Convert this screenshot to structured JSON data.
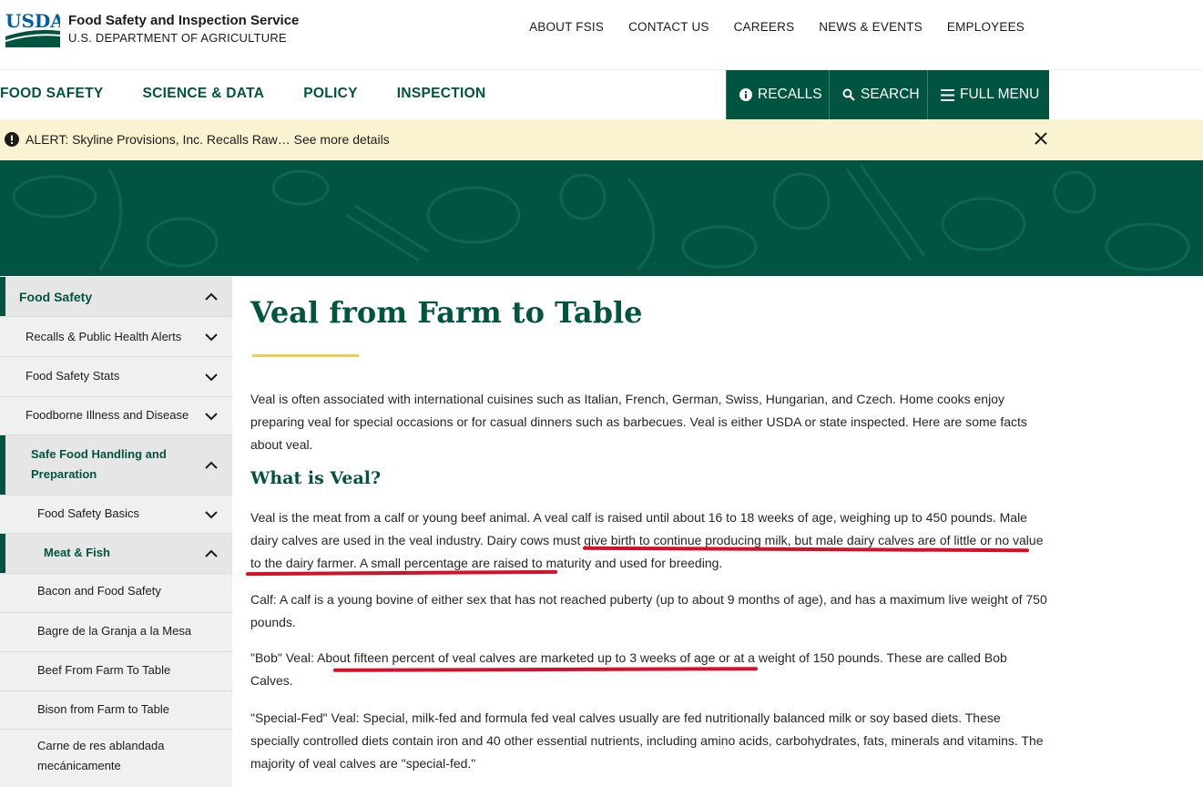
{
  "header": {
    "logo_text": "USDA",
    "agency_name": "Food Safety and Inspection Service",
    "department": "U.S. DEPARTMENT OF AGRICULTURE",
    "utility_links": [
      "ABOUT FSIS",
      "CONTACT US",
      "CAREERS",
      "NEWS & EVENTS",
      "EMPLOYEES"
    ]
  },
  "nav": {
    "links": [
      "FOOD SAFETY",
      "SCIENCE & DATA",
      "POLICY",
      "INSPECTION"
    ],
    "recalls_label": "RECALLS",
    "search_label": "SEARCH",
    "menu_label": "FULL MENU"
  },
  "alert": {
    "text": "ALERT: Skyline Provisions, Inc. Recalls Raw… See more details"
  },
  "sidebar": {
    "items": [
      {
        "label": "Food Safety",
        "chevron": "up"
      },
      {
        "label": "Recalls & Public Health Alerts",
        "chevron": "down"
      },
      {
        "label": "Food Safety Stats",
        "chevron": "down"
      },
      {
        "label": "Foodborne Illness and Disease",
        "chevron": "down"
      },
      {
        "label": "Safe Food Handling and Preparation",
        "chevron": "up"
      },
      {
        "label": "Food Safety Basics",
        "chevron": "down"
      },
      {
        "label": "Meat & Fish",
        "chevron": "up"
      },
      {
        "label": "Bacon and Food Safety"
      },
      {
        "label": "Bagre de la Granja a la Mesa"
      },
      {
        "label": "Beef From Farm To Table"
      },
      {
        "label": "Bison from Farm to Table"
      },
      {
        "label": "Carne de res ablandada mecánicamente"
      }
    ]
  },
  "main": {
    "title": "Veal from Farm to Table",
    "intro": "Veal is often associated with international cuisines such as Italian, French, German, Swiss, Hungarian, and Czech. Home cooks enjoy preparing veal for special occasions or for casual dinners such as barbecues. Veal is either USDA or state inspected. Here are some facts about veal.",
    "what_heading": "What is Veal?",
    "p1": "Veal is the meat from a calf or young beef animal. A veal calf is raised until about 16 to 18 weeks of age, weighing up to 450 pounds. Male dairy calves are used in the veal industry. Dairy cows must give birth to continue producing milk, but male dairy calves are of little or no value to the dairy farmer. A small percentage are raised to maturity and used for breeding.",
    "p2": "Calf: A calf is a young bovine of either sex that has not reached puberty (up to about 9 months of age), and has a maximum live weight of 750 pounds.",
    "p3": "\"Bob\" Veal: About fifteen percent of veal calves are marketed up to 3 weeks of age or at a weight of 150 pounds. These are called Bob Calves.",
    "p4": "\"Special-Fed\" Veal: Special, milk-fed and formula fed veal calves usually are fed nutritionally balanced milk or soy based diets. These specially controlled diets contain iron and 40 other essential nutrients, including amino acids, carbohydrates, fats, minerals and vitamins. The majority of veal calves are \"special-fed.\""
  },
  "colors": {
    "brand_green": "#005440",
    "alert_bg": "#faf3d1",
    "accent_gold": "#f2c94c",
    "annotation_red": "#d4102a",
    "sidebar_bg": "#f0f0f0"
  },
  "icons": [
    "usda-logo",
    "info-circle-icon",
    "search-icon",
    "menu-icon",
    "close-icon",
    "chevron-up-icon",
    "chevron-down-icon"
  ]
}
